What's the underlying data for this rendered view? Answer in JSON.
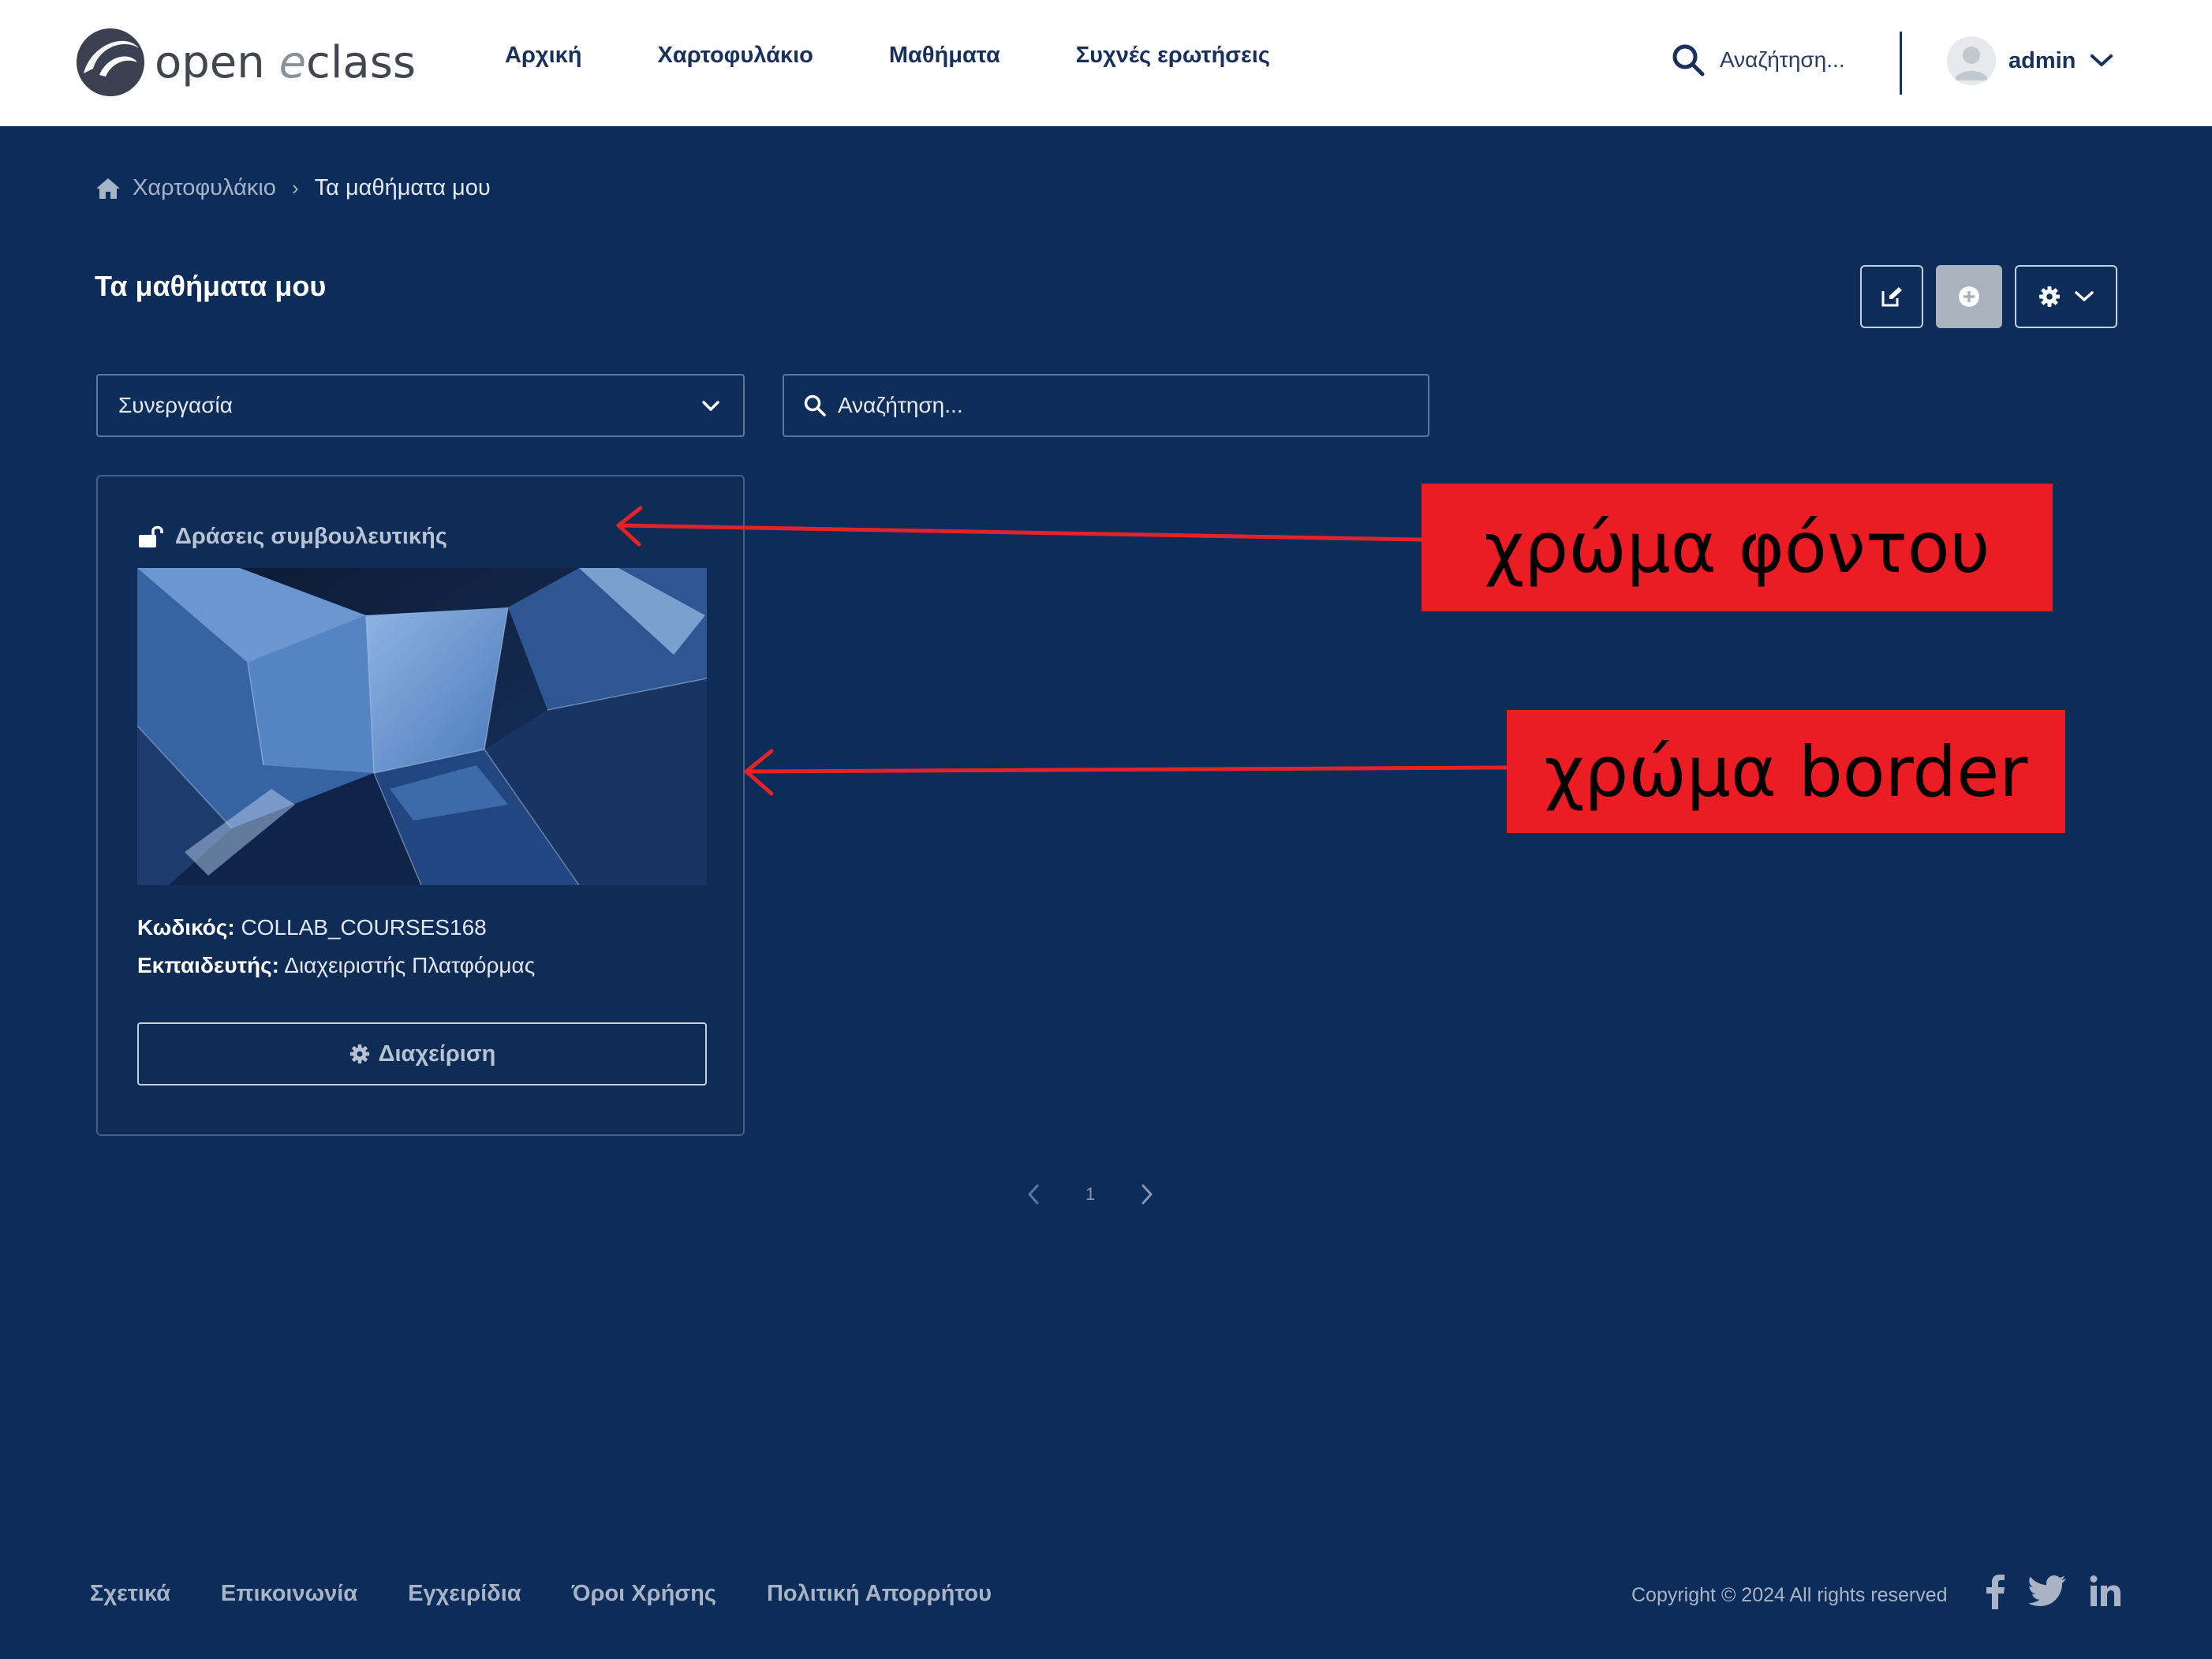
{
  "header": {
    "logo": {
      "open": "open",
      "e": "e",
      "class": "class"
    },
    "nav": [
      "Αρχική",
      "Χαρτοφυλάκιο",
      "Μαθήματα",
      "Συχνές ερωτήσεις"
    ],
    "search_placeholder": "Αναζήτηση...",
    "user_name": "admin"
  },
  "breadcrumb": {
    "root": "Χαρτοφυλάκιο",
    "current": "Τα μαθήματα μου"
  },
  "page_title": "Τα μαθήματα μου",
  "filters": {
    "selected_type": "Συνεργασία",
    "search_placeholder": "Αναζήτηση..."
  },
  "course_card": {
    "title": "Δράσεις συμβουλευτικής",
    "code_label": "Κωδικός:",
    "code_value": "COLLAB_COURSES168",
    "instructor_label": "Εκπαιδευτής:",
    "instructor_value": "Διαχειριστής Πλατφόρμας",
    "manage_label": "Διαχείριση",
    "lock_icon": "unlock-icon"
  },
  "pagination": {
    "current_page": "1"
  },
  "annotations": {
    "background_color": "χρώμα φόντου",
    "border_color": "χρώμα border"
  },
  "footer": {
    "links": [
      "Σχετικά",
      "Επικοινωνία",
      "Εγχειρίδια",
      "Όροι Χρήσης",
      "Πολιτική Απορρήτου"
    ],
    "copyright": "Copyright © 2024 All rights reserved",
    "social_icons": [
      "facebook-icon",
      "twitter-icon",
      "linkedin-icon"
    ]
  },
  "colors": {
    "page_bg": "#0c2c59",
    "header_bg": "#ffffff",
    "nav_text": "#17305c",
    "annotation_red": "#ec1c24",
    "card_border": "#455f84"
  }
}
